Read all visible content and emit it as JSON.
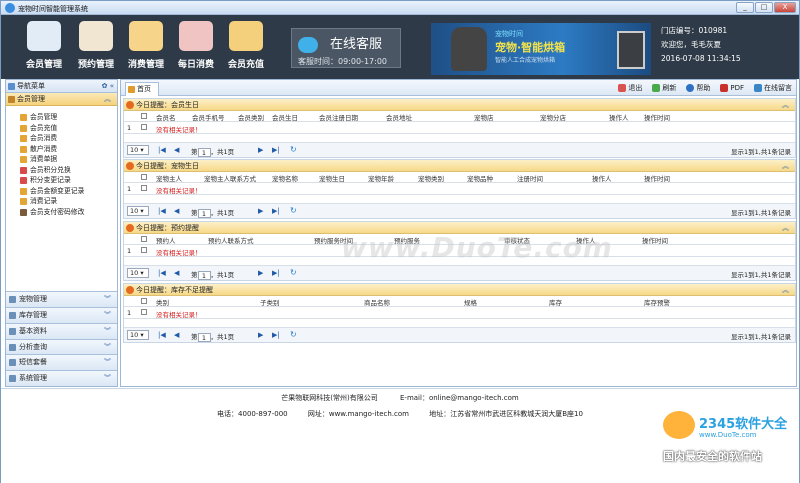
{
  "window": {
    "title": "宠物时间智能管理系统",
    "buttons": [
      "_",
      "□",
      "X"
    ]
  },
  "nav": [
    {
      "label": "会员管理",
      "icon": "members-icon",
      "color": "#e1ecf7"
    },
    {
      "label": "预约管理",
      "icon": "appointment-icon",
      "color": "#f1e6d2"
    },
    {
      "label": "消费管理",
      "icon": "shopping-basket-icon",
      "color": "#f6d58a"
    },
    {
      "label": "每日消费",
      "icon": "cash-register-icon",
      "color": "#f1c4c4"
    },
    {
      "label": "会员充值",
      "icon": "credit-card-icon",
      "color": "#f4d07c"
    }
  ],
  "service": {
    "title": "在线客服",
    "hours": "客服时间：09:00-17:00"
  },
  "banner": {
    "small": "宠物时间",
    "big": "宠物·智能烘箱",
    "sub": "智能人工合成宠物烘箱"
  },
  "info": {
    "store": "门店编号：010981",
    "welcome": "欢迎您，毛毛灰夏",
    "datetime": "2016-07-08 11:34:15"
  },
  "sidebar": {
    "title": "导航菜单",
    "section": "会员管理",
    "items": [
      "会员管理",
      "会员充值",
      "会员消费",
      "散户消费",
      "消费单据",
      "会员积分兑换",
      "积分变更记录",
      "会员金额变更记录",
      "消费记录",
      "会员支付密码修改"
    ],
    "bottom": [
      "宠物管理",
      "库存管理",
      "基本资料",
      "分析查询",
      "短信套餐",
      "系统管理"
    ]
  },
  "tabs": {
    "home": "首页"
  },
  "tools": [
    "退出",
    "刷新",
    "帮助",
    "PDF",
    "在线留言"
  ],
  "panels": [
    {
      "title": "今日提醒：会员生日",
      "cols": [
        "会员名",
        "会员手机号",
        "会员类别",
        "会员生日",
        "会员注册日期",
        "会员地址",
        "宠物店",
        "宠物分店",
        "操作人",
        "操作时间"
      ]
    },
    {
      "title": "今日提醒：宠物生日",
      "cols": [
        "宠物主人",
        "宠物主人联系方式",
        "宠物名称",
        "宠物生日",
        "宠物年龄",
        "宠物类别",
        "宠物品种",
        "注册时间",
        "操作人",
        "操作时间"
      ]
    },
    {
      "title": "今日提醒：预约提醒",
      "cols": [
        "预约人",
        "预约人联系方式",
        "预约服务时间",
        "预约服务",
        "审核状态",
        "操作人",
        "操作时间"
      ]
    },
    {
      "title": "今日提醒：库存不足提醒",
      "cols": [
        "类别",
        "子类别",
        "商品名称",
        "规格",
        "库存",
        "库存预警"
      ]
    }
  ],
  "grid": {
    "row_num": "1",
    "no_record": "没有相关记录！",
    "page_size": "10",
    "page_prefix": "第",
    "page_value": "1",
    "page_suffix": "，共1页",
    "total": "显示1到1,共1条记录"
  },
  "footer": {
    "company": "芒果物联网科技(常州)有限公司",
    "email": "E-mail：online@mango-itech.com",
    "phone": "电话：4000-897-000",
    "site": "网址：www.mango-itech.com",
    "address": "地址：江苏省常州市武进区科教城天润大厦B座10"
  },
  "watermark": "www.DuoTe.com",
  "site_logo": {
    "title": "2345软件大全",
    "url": "www.DuoTe.com",
    "slogan": "国内最安全的软件站"
  }
}
